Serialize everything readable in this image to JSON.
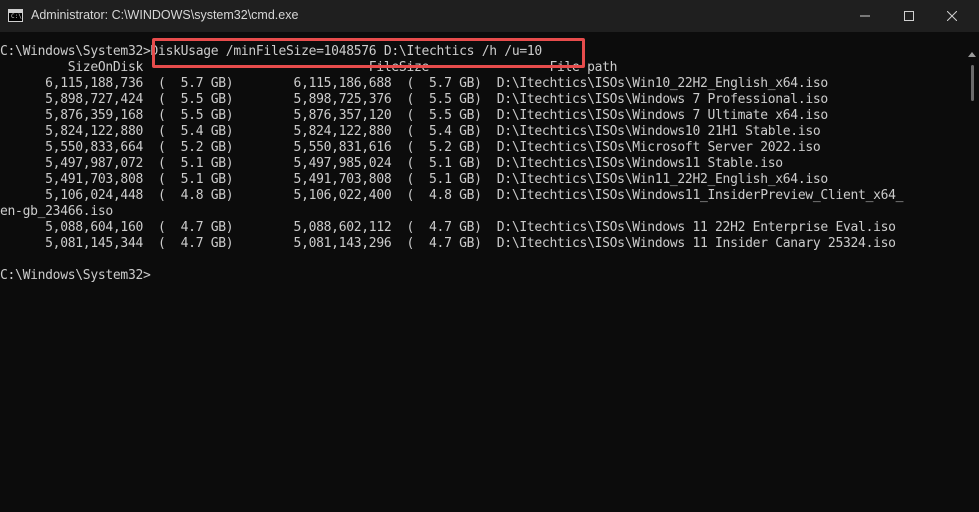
{
  "window": {
    "title": "Administrator: C:\\WINDOWS\\system32\\cmd.exe",
    "app_icon_text": "C:\\"
  },
  "console": {
    "lines": [
      "C:\\Windows\\System32>DiskUsage /minFileSize=1048576 D:\\Itechtics /h /u=10",
      "         SizeOnDisk                              FileSize                File path",
      "      6,115,188,736  (  5.7 GB)        6,115,186,688  (  5.7 GB)  D:\\Itechtics\\ISOs\\Win10_22H2_English_x64.iso",
      "      5,898,727,424  (  5.5 GB)        5,898,725,376  (  5.5 GB)  D:\\Itechtics\\ISOs\\Windows 7 Professional.iso",
      "      5,876,359,168  (  5.5 GB)        5,876,357,120  (  5.5 GB)  D:\\Itechtics\\ISOs\\Windows 7 Ultimate x64.iso",
      "      5,824,122,880  (  5.4 GB)        5,824,122,880  (  5.4 GB)  D:\\Itechtics\\ISOs\\Windows10 21H1 Stable.iso",
      "      5,550,833,664  (  5.2 GB)        5,550,831,616  (  5.2 GB)  D:\\Itechtics\\ISOs\\Microsoft Server 2022.iso",
      "      5,497,987,072  (  5.1 GB)        5,497,985,024  (  5.1 GB)  D:\\Itechtics\\ISOs\\Windows11 Stable.iso",
      "      5,491,703,808  (  5.1 GB)        5,491,703,808  (  5.1 GB)  D:\\Itechtics\\ISOs\\Win11_22H2_English_x64.iso",
      "      5,106,024,448  (  4.8 GB)        5,106,022,400  (  4.8 GB)  D:\\Itechtics\\ISOs\\Windows11_InsiderPreview_Client_x64_",
      "en-gb_23466.iso",
      "      5,088,604,160  (  4.7 GB)        5,088,602,112  (  4.7 GB)  D:\\Itechtics\\ISOs\\Windows 11 22H2 Enterprise Eval.iso",
      "      5,081,145,344  (  4.7 GB)        5,081,143,296  (  4.7 GB)  D:\\Itechtics\\ISOs\\Windows 11 Insider Canary 25324.iso",
      "",
      "C:\\Windows\\System32>"
    ]
  },
  "colors": {
    "background": "#0c0c0c",
    "titlebar": "#1f1f1f",
    "text": "#cccccc",
    "highlight_box": "#e74c4c"
  },
  "icons": {
    "minimize": "minimize-icon",
    "maximize": "maximize-icon",
    "close": "close-icon"
  }
}
